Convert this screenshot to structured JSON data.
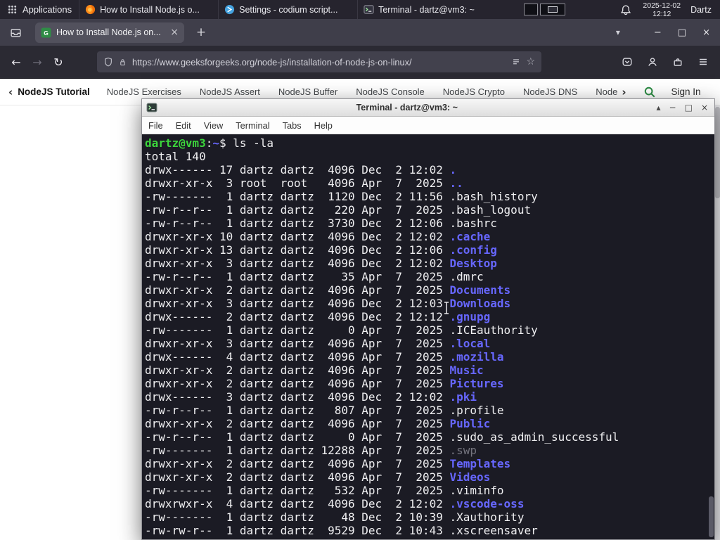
{
  "colors": {
    "gfg_green": "#2f8d46",
    "terminal_bg": "#1b1b24",
    "terminal_fg": "#efeff1",
    "prompt_green": "#3cd53c",
    "dir_blue": "#6767ff",
    "dim_gray": "#74747e"
  },
  "icons": {
    "back": "←",
    "forward": "→",
    "reload": "↻",
    "star": "☆",
    "new_tab": "+",
    "close": "×",
    "minimize": "−",
    "maximize": "□",
    "tabs_chevron": "▾",
    "shade": "▴",
    "chevron_left": "‹",
    "chevron_right": "›"
  },
  "panel": {
    "applications_label": "Applications",
    "tasks": [
      {
        "label": "How to Install Node.js o..."
      },
      {
        "label": "Settings - codium script..."
      },
      {
        "label": "Terminal - dartz@vm3: ~"
      }
    ],
    "clock": {
      "date": "2025-12-02",
      "time": "12:12"
    },
    "user": "Dartz"
  },
  "browser": {
    "tab_title": "How to Install Node.js on...",
    "url": "https://www.geeksforgeeks.org/node-js/installation-of-node-js-on-linux/",
    "subnav": {
      "active_label": "NodeJS Tutorial",
      "links": [
        "NodeJS Exercises",
        "NodeJS Assert",
        "NodeJS Buffer",
        "NodeJS Console",
        "NodeJS Crypto",
        "NodeJS DNS",
        "Node"
      ],
      "signin_label": "Sign In"
    }
  },
  "terminal": {
    "title": "Terminal - dartz@vm3: ~",
    "menu_items": [
      "File",
      "Edit",
      "View",
      "Terminal",
      "Tabs",
      "Help"
    ],
    "prompt": {
      "user_host": "dartz@vm3",
      "separator": ":",
      "path": "~",
      "symbol": "$",
      "command": "ls -la"
    },
    "total_line": "total 140",
    "listing": [
      {
        "pre": "drwx------ 17 dartz dartz  4096 Dec  2 12:02 ",
        "name": ".",
        "type": "dir"
      },
      {
        "pre": "drwxr-xr-x  3 root  root   4096 Apr  7  2025 ",
        "name": "..",
        "type": "dir"
      },
      {
        "pre": "-rw-------  1 dartz dartz  1120 Dec  2 11:56 ",
        "name": ".bash_history",
        "type": "file"
      },
      {
        "pre": "-rw-r--r--  1 dartz dartz   220 Apr  7  2025 ",
        "name": ".bash_logout",
        "type": "file"
      },
      {
        "pre": "-rw-r--r--  1 dartz dartz  3730 Dec  2 12:06 ",
        "name": ".bashrc",
        "type": "file"
      },
      {
        "pre": "drwxr-xr-x 10 dartz dartz  4096 Dec  2 12:02 ",
        "name": ".cache",
        "type": "dir"
      },
      {
        "pre": "drwxr-xr-x 13 dartz dartz  4096 Dec  2 12:06 ",
        "name": ".config",
        "type": "dir"
      },
      {
        "pre": "drwxr-xr-x  3 dartz dartz  4096 Dec  2 12:02 ",
        "name": "Desktop",
        "type": "dir"
      },
      {
        "pre": "-rw-r--r--  1 dartz dartz    35 Apr  7  2025 ",
        "name": ".dmrc",
        "type": "file"
      },
      {
        "pre": "drwxr-xr-x  2 dartz dartz  4096 Apr  7  2025 ",
        "name": "Documents",
        "type": "dir"
      },
      {
        "pre": "drwxr-xr-x  3 dartz dartz  4096 Dec  2 12:03 ",
        "name": "Downloads",
        "type": "dir"
      },
      {
        "pre": "drwx------  2 dartz dartz  4096 Dec  2 12:12 ",
        "name": ".gnupg",
        "type": "dir"
      },
      {
        "pre": "-rw-------  1 dartz dartz     0 Apr  7  2025 ",
        "name": ".ICEauthority",
        "type": "file"
      },
      {
        "pre": "drwxr-xr-x  3 dartz dartz  4096 Apr  7  2025 ",
        "name": ".local",
        "type": "dir"
      },
      {
        "pre": "drwx------  4 dartz dartz  4096 Apr  7  2025 ",
        "name": ".mozilla",
        "type": "dir"
      },
      {
        "pre": "drwxr-xr-x  2 dartz dartz  4096 Apr  7  2025 ",
        "name": "Music",
        "type": "dir"
      },
      {
        "pre": "drwxr-xr-x  2 dartz dartz  4096 Apr  7  2025 ",
        "name": "Pictures",
        "type": "dir"
      },
      {
        "pre": "drwx------  3 dartz dartz  4096 Dec  2 12:02 ",
        "name": ".pki",
        "type": "dir"
      },
      {
        "pre": "-rw-r--r--  1 dartz dartz   807 Apr  7  2025 ",
        "name": ".profile",
        "type": "file"
      },
      {
        "pre": "drwxr-xr-x  2 dartz dartz  4096 Apr  7  2025 ",
        "name": "Public",
        "type": "dir"
      },
      {
        "pre": "-rw-r--r--  1 dartz dartz     0 Apr  7  2025 ",
        "name": ".sudo_as_admin_successful",
        "type": "file"
      },
      {
        "pre": "-rw-------  1 dartz dartz 12288 Apr  7  2025 ",
        "name": ".swp",
        "type": "dim"
      },
      {
        "pre": "drwxr-xr-x  2 dartz dartz  4096 Apr  7  2025 ",
        "name": "Templates",
        "type": "dir"
      },
      {
        "pre": "drwxr-xr-x  2 dartz dartz  4096 Apr  7  2025 ",
        "name": "Videos",
        "type": "dir"
      },
      {
        "pre": "-rw-------  1 dartz dartz   532 Apr  7  2025 ",
        "name": ".viminfo",
        "type": "file"
      },
      {
        "pre": "drwxrwxr-x  4 dartz dartz  4096 Dec  2 12:02 ",
        "name": ".vscode-oss",
        "type": "dir"
      },
      {
        "pre": "-rw-------  1 dartz dartz    48 Dec  2 10:39 ",
        "name": ".Xauthority",
        "type": "file"
      },
      {
        "pre": "-rw-rw-r--  1 dartz dartz  9529 Dec  2 10:43 ",
        "name": ".xscreensaver",
        "type": "file"
      }
    ]
  }
}
